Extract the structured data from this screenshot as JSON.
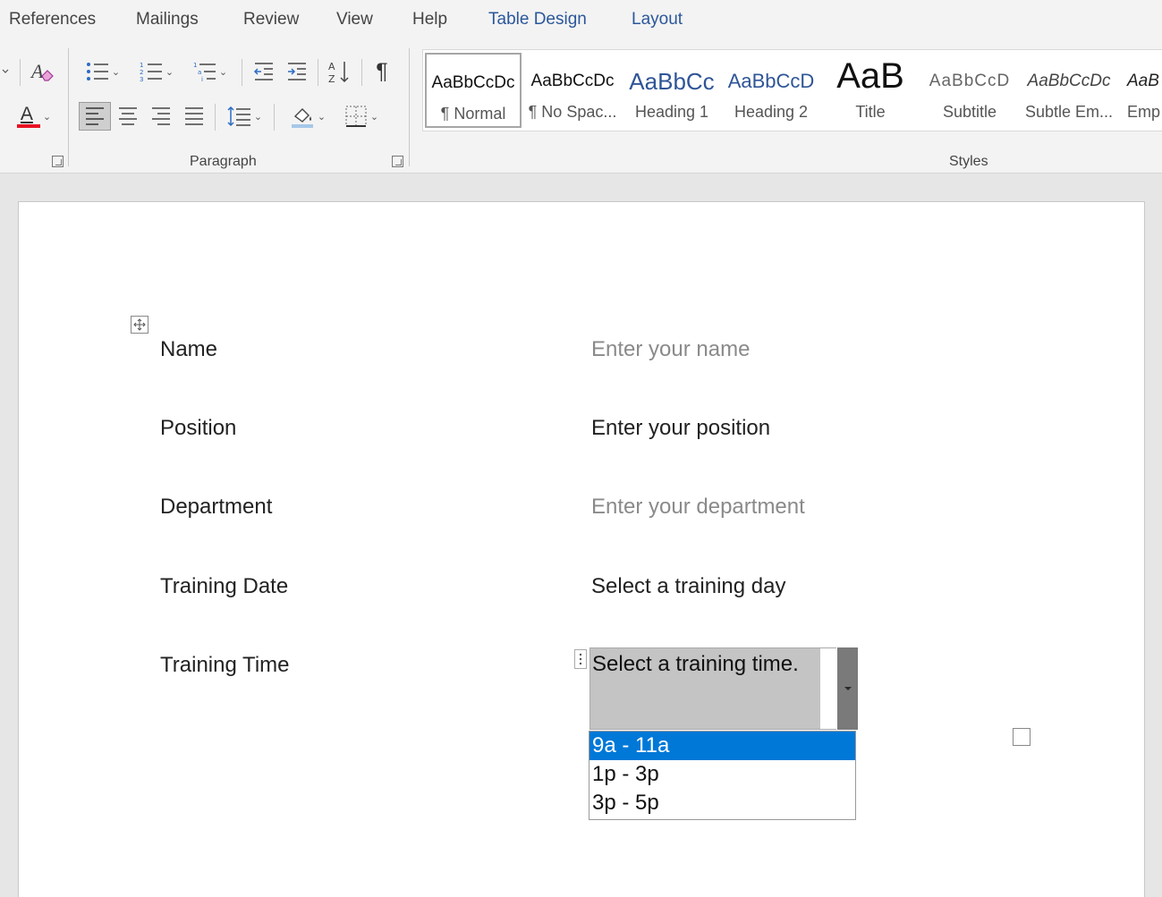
{
  "tabs": [
    "References",
    "Mailings",
    "Review",
    "View",
    "Help",
    "Table Design",
    "Layout"
  ],
  "ribbon": {
    "paragraph_label": "Paragraph",
    "styles_label": "Styles",
    "pilcrow": "¶",
    "font_color_glyph": "A",
    "styles": [
      {
        "sample": "AaBbCcDc",
        "name": "¶ Normal"
      },
      {
        "sample": "AaBbCcDc",
        "name": "¶ No Spac..."
      },
      {
        "sample": "AaBbCc",
        "name": "Heading 1"
      },
      {
        "sample": "AaBbCcD",
        "name": "Heading 2"
      },
      {
        "sample": "AaB",
        "name": "Title"
      },
      {
        "sample": "AaBbCcD",
        "name": "Subtitle"
      },
      {
        "sample": "AaBbCcDc",
        "name": "Subtle Em..."
      },
      {
        "sample": "AaB",
        "name": "Emp"
      }
    ],
    "icons": [
      "clear-formatting-icon",
      "font-color-icon",
      "bullets-icon",
      "numbering-icon",
      "multilevel-list-icon",
      "decrease-indent-icon",
      "increase-indent-icon",
      "sort-icon",
      "show-hide-icon",
      "align-left-icon",
      "center-icon",
      "align-right-icon",
      "justify-icon",
      "line-spacing-icon",
      "shading-icon",
      "borders-icon"
    ]
  },
  "colors": {
    "contextual_tab": "#2b579a",
    "font_color_bar": "#e81123",
    "shading_bar": "#a6c8e8",
    "highlight": "#0078d7",
    "placeholder": "#8a8a8a"
  },
  "form": {
    "rows": [
      {
        "label": "Name",
        "value": "Enter your name"
      },
      {
        "label": "Position",
        "value": "Enter your position"
      },
      {
        "label": "Department",
        "value": "Enter your department"
      },
      {
        "label": "Training Date",
        "value": "Select a training day"
      },
      {
        "label": "Training Time",
        "value": "Select a training time."
      }
    ],
    "time_options": [
      "9a - 11a",
      "1p - 3p",
      "3p - 5p"
    ]
  }
}
